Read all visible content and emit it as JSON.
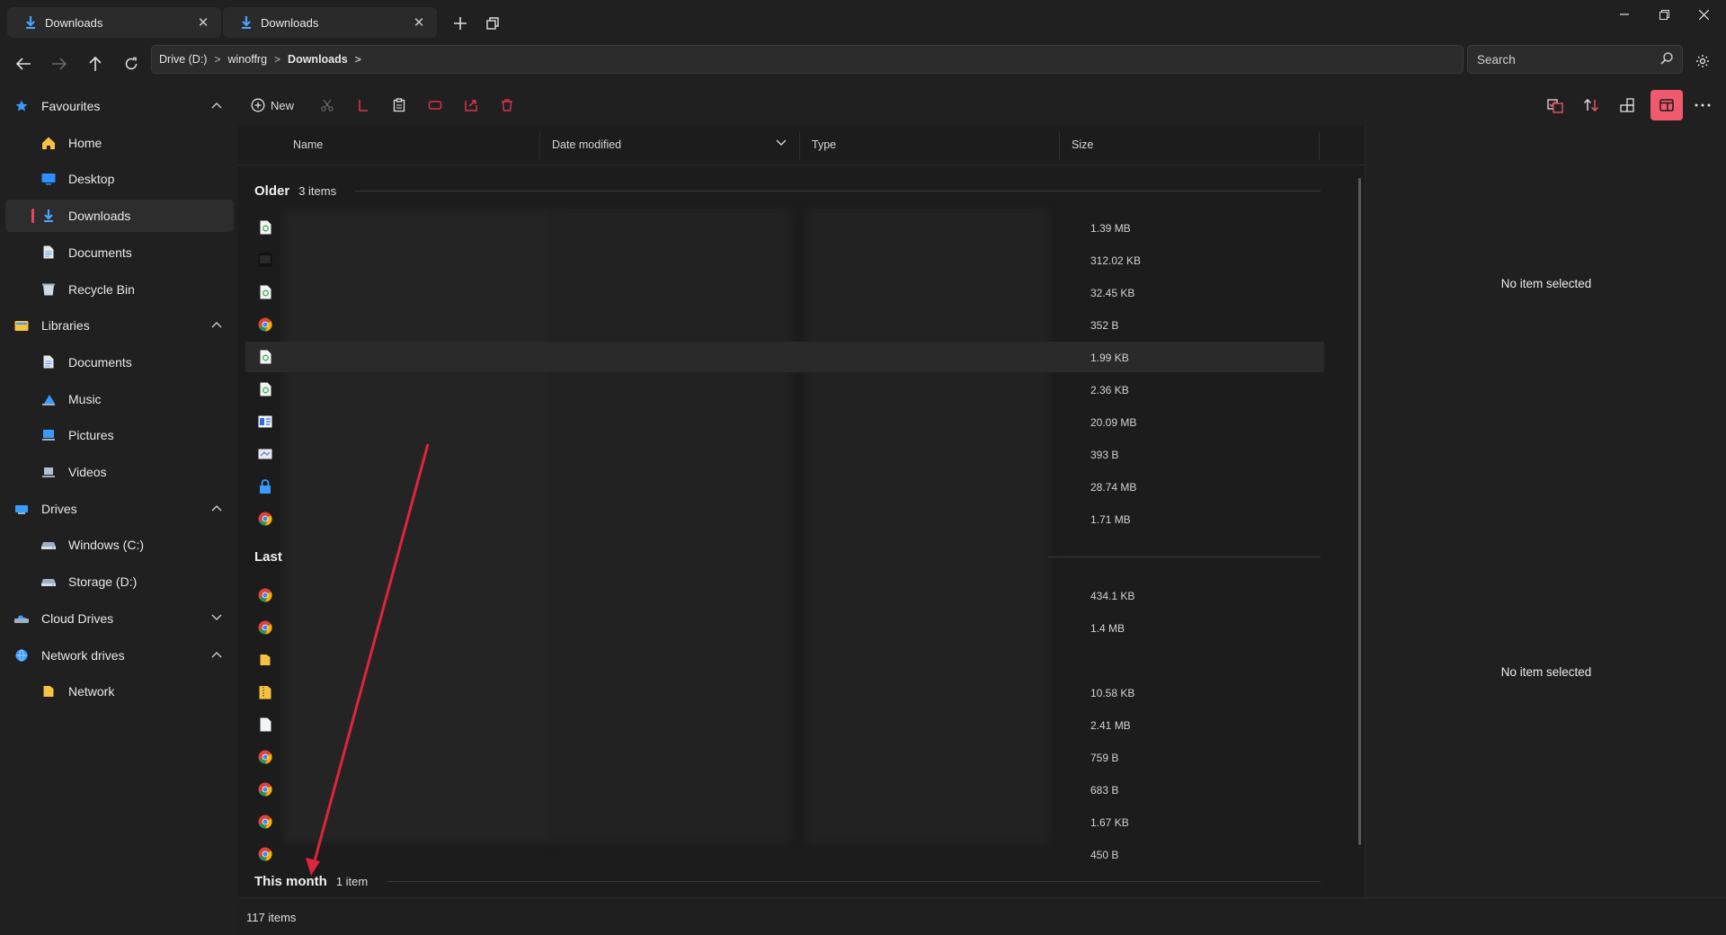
{
  "tabs": [
    {
      "label": "Downloads",
      "active": true
    },
    {
      "label": "Downloads",
      "active": false
    }
  ],
  "breadcrumb": [
    {
      "label": "Drive (D:)"
    },
    {
      "label": "winoffrg"
    },
    {
      "label": "Downloads"
    }
  ],
  "search": {
    "placeholder": "Search"
  },
  "sidebar": {
    "items": [
      {
        "label": "Favourites",
        "type": "section",
        "icon": "star-icon"
      },
      {
        "label": "Home",
        "type": "child",
        "icon": "home-icon"
      },
      {
        "label": "Desktop",
        "type": "child",
        "icon": "desktop-icon"
      },
      {
        "label": "Downloads",
        "type": "child",
        "icon": "download-icon",
        "selected": true
      },
      {
        "label": "Documents",
        "type": "child",
        "icon": "document-icon"
      },
      {
        "label": "Recycle Bin",
        "type": "child",
        "icon": "recycle-bin-icon"
      },
      {
        "label": "Libraries",
        "type": "section",
        "icon": "library-icon"
      },
      {
        "label": "Documents",
        "type": "child",
        "icon": "document-icon"
      },
      {
        "label": "Music",
        "type": "child",
        "icon": "music-icon"
      },
      {
        "label": "Pictures",
        "type": "child",
        "icon": "pictures-icon"
      },
      {
        "label": "Videos",
        "type": "child",
        "icon": "videos-icon"
      },
      {
        "label": "Drives",
        "type": "section",
        "icon": "drives-icon"
      },
      {
        "label": "Windows (C:)",
        "type": "child",
        "icon": "drive-icon"
      },
      {
        "label": "Storage (D:)",
        "type": "child",
        "icon": "drive-icon"
      },
      {
        "label": "Cloud Drives",
        "type": "section",
        "icon": "cloud-icon"
      },
      {
        "label": "Network drives",
        "type": "section",
        "icon": "network-drive-icon"
      },
      {
        "label": "Network",
        "type": "child",
        "icon": "network-icon"
      }
    ]
  },
  "toolbar": {
    "new_label": "New"
  },
  "columns": {
    "name": "Name",
    "date": "Date modified",
    "type": "Type",
    "size": "Size"
  },
  "groups": {
    "older": {
      "title": "Older",
      "count": "3 items"
    },
    "last": {
      "title": "Last"
    },
    "this_month": {
      "title": "This month",
      "count": "1 item"
    }
  },
  "files_older": [
    {
      "size": "1.39 MB",
      "icon": "text-file-icon"
    },
    {
      "size": "312.02 KB",
      "icon": "image-file-icon"
    },
    {
      "size": "32.45 KB",
      "icon": "text-file-icon"
    },
    {
      "size": "352 B",
      "icon": "chrome-icon"
    },
    {
      "size": "1.99 KB",
      "icon": "text-file-icon",
      "selected": true
    },
    {
      "size": "2.36 KB",
      "icon": "text-file-icon"
    },
    {
      "size": "20.09 MB",
      "icon": "app-file-icon"
    },
    {
      "size": "393 B",
      "icon": "shortcut-file-icon"
    },
    {
      "size": "28.74 MB",
      "icon": "lock-file-icon"
    },
    {
      "size": "1.71 MB",
      "icon": "chrome-icon"
    }
  ],
  "files_last": [
    {
      "size": "434.1 KB",
      "icon": "chrome-icon"
    },
    {
      "size": "1.4 MB",
      "icon": "chrome-icon"
    },
    {
      "size": "",
      "icon": "folder-icon"
    },
    {
      "size": "10.58 KB",
      "icon": "zip-folder-icon"
    },
    {
      "size": "2.41 MB",
      "icon": "blank-file-icon"
    },
    {
      "size": "759 B",
      "icon": "chrome-icon"
    },
    {
      "size": "683 B",
      "icon": "chrome-icon"
    },
    {
      "size": "1.67 KB",
      "icon": "chrome-icon"
    },
    {
      "size": "450 B",
      "icon": "chrome-icon"
    }
  ],
  "details": {
    "message_top": "No item selected",
    "message_bottom": "No item selected"
  },
  "status": {
    "item_count": "117 items"
  },
  "colors": {
    "accent": "#f05a6e",
    "annotation_arrow": "#e0243c"
  }
}
